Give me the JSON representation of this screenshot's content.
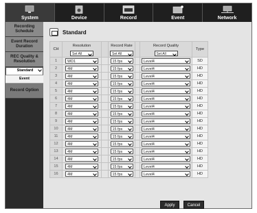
{
  "tabs": [
    {
      "label": "System",
      "icon": "system-monitor-icon"
    },
    {
      "label": "Device",
      "icon": "device-camera-icon"
    },
    {
      "label": "Record",
      "icon": "record-rec-icon"
    },
    {
      "label": "Event",
      "icon": "event-icon"
    },
    {
      "label": "Network",
      "icon": "network-icon"
    }
  ],
  "sidebar": {
    "items": [
      {
        "label": "Recording Schedule"
      },
      {
        "label": "Event Record Duration"
      },
      {
        "label": "REC Quality & Resolution"
      },
      {
        "label": "Standard"
      },
      {
        "label": "Event"
      },
      {
        "label": "Record Option"
      }
    ]
  },
  "page": {
    "title": "Standard",
    "title_icon": "standard-record-icon"
  },
  "table": {
    "headers": {
      "ch": "CH",
      "resolution": "Resolution",
      "rate": "Record Rate",
      "quality": "Record Quality",
      "type": "Type"
    },
    "header_selects": {
      "resolution": "Set All",
      "rate": "Set All",
      "quality": "Set All"
    },
    "rows": [
      {
        "ch": "1",
        "resolution": "WD1",
        "rate": "15 fps",
        "quality": "Level4",
        "type": "SD"
      },
      {
        "ch": "2",
        "resolution": "4M",
        "rate": "15 fps",
        "quality": "Level4",
        "type": "HD"
      },
      {
        "ch": "3",
        "resolution": "4M",
        "rate": "15 fps",
        "quality": "Level4",
        "type": "HD"
      },
      {
        "ch": "4",
        "resolution": "4M",
        "rate": "15 fps",
        "quality": "Level4",
        "type": "HD"
      },
      {
        "ch": "5",
        "resolution": "4M",
        "rate": "15 fps",
        "quality": "Level4",
        "type": "HD"
      },
      {
        "ch": "6",
        "resolution": "4M",
        "rate": "15 fps",
        "quality": "Level4",
        "type": "HD"
      },
      {
        "ch": "7",
        "resolution": "4M",
        "rate": "15 fps",
        "quality": "Level4",
        "type": "HD"
      },
      {
        "ch": "8",
        "resolution": "4M",
        "rate": "15 fps",
        "quality": "Level4",
        "type": "HD"
      },
      {
        "ch": "9",
        "resolution": "4M",
        "rate": "15 fps",
        "quality": "Level4",
        "type": "HD"
      },
      {
        "ch": "10",
        "resolution": "4M",
        "rate": "15 fps",
        "quality": "Level4",
        "type": "HD"
      },
      {
        "ch": "11",
        "resolution": "4M",
        "rate": "15 fps",
        "quality": "Level4",
        "type": "HD"
      },
      {
        "ch": "12",
        "resolution": "4M",
        "rate": "15 fps",
        "quality": "Level4",
        "type": "HD"
      },
      {
        "ch": "13",
        "resolution": "4M",
        "rate": "15 fps",
        "quality": "Level4",
        "type": "HD"
      },
      {
        "ch": "14",
        "resolution": "4M",
        "rate": "15 fps",
        "quality": "Level4",
        "type": "HD"
      },
      {
        "ch": "15",
        "resolution": "4M",
        "rate": "15 fps",
        "quality": "Level4",
        "type": "HD"
      },
      {
        "ch": "16",
        "resolution": "4M",
        "rate": "15 fps",
        "quality": "Level4",
        "type": "HD"
      }
    ]
  },
  "buttons": {
    "apply": "Apply",
    "cancel": "Cancel"
  }
}
